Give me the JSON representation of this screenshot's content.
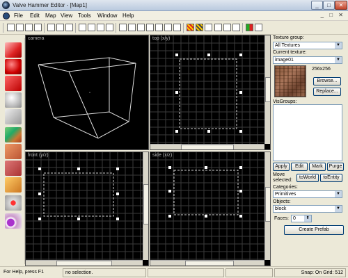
{
  "window": {
    "title": "Valve Hammer Editor - [Map1]",
    "min_glyph": "_",
    "max_glyph": "□",
    "close_glyph": "✕"
  },
  "menu": {
    "items": [
      "File",
      "Edit",
      "Map",
      "View",
      "Tools",
      "Window",
      "Help"
    ],
    "doc_controls": "_ □ ✕"
  },
  "viewports": {
    "camera": {
      "label": "camera"
    },
    "top": {
      "label": "top (x/y)"
    },
    "front": {
      "label": "front (y/z)"
    },
    "side": {
      "label": "side (x/z)"
    }
  },
  "right_panel": {
    "texture_group_label": "Texture group:",
    "texture_group_value": "All Textures",
    "current_texture_label": "Current texture:",
    "current_texture_value": "image01",
    "texture_size": "256x256",
    "browse_label": "Browse...",
    "replace_label": "Replace...",
    "visgroups_label": "VisGroups:",
    "apply_label": "Apply",
    "edit_label": "Edit",
    "mark_label": "Mark",
    "purge_label": "Purge",
    "move_selected_label": "Move selected:",
    "to_world_label": "toWorld",
    "to_entity_label": "toEntity",
    "categories_label": "Categories:",
    "categories_value": "Primitives",
    "objects_label": "Objects:",
    "objects_value": "block",
    "faces_label": "Faces:",
    "faces_value": "0",
    "create_prefab_label": "Create Prefab"
  },
  "statusbar": {
    "help": "For Help, press F1",
    "selection": "no selection.",
    "snap": "Snap: On Grid: 512"
  }
}
